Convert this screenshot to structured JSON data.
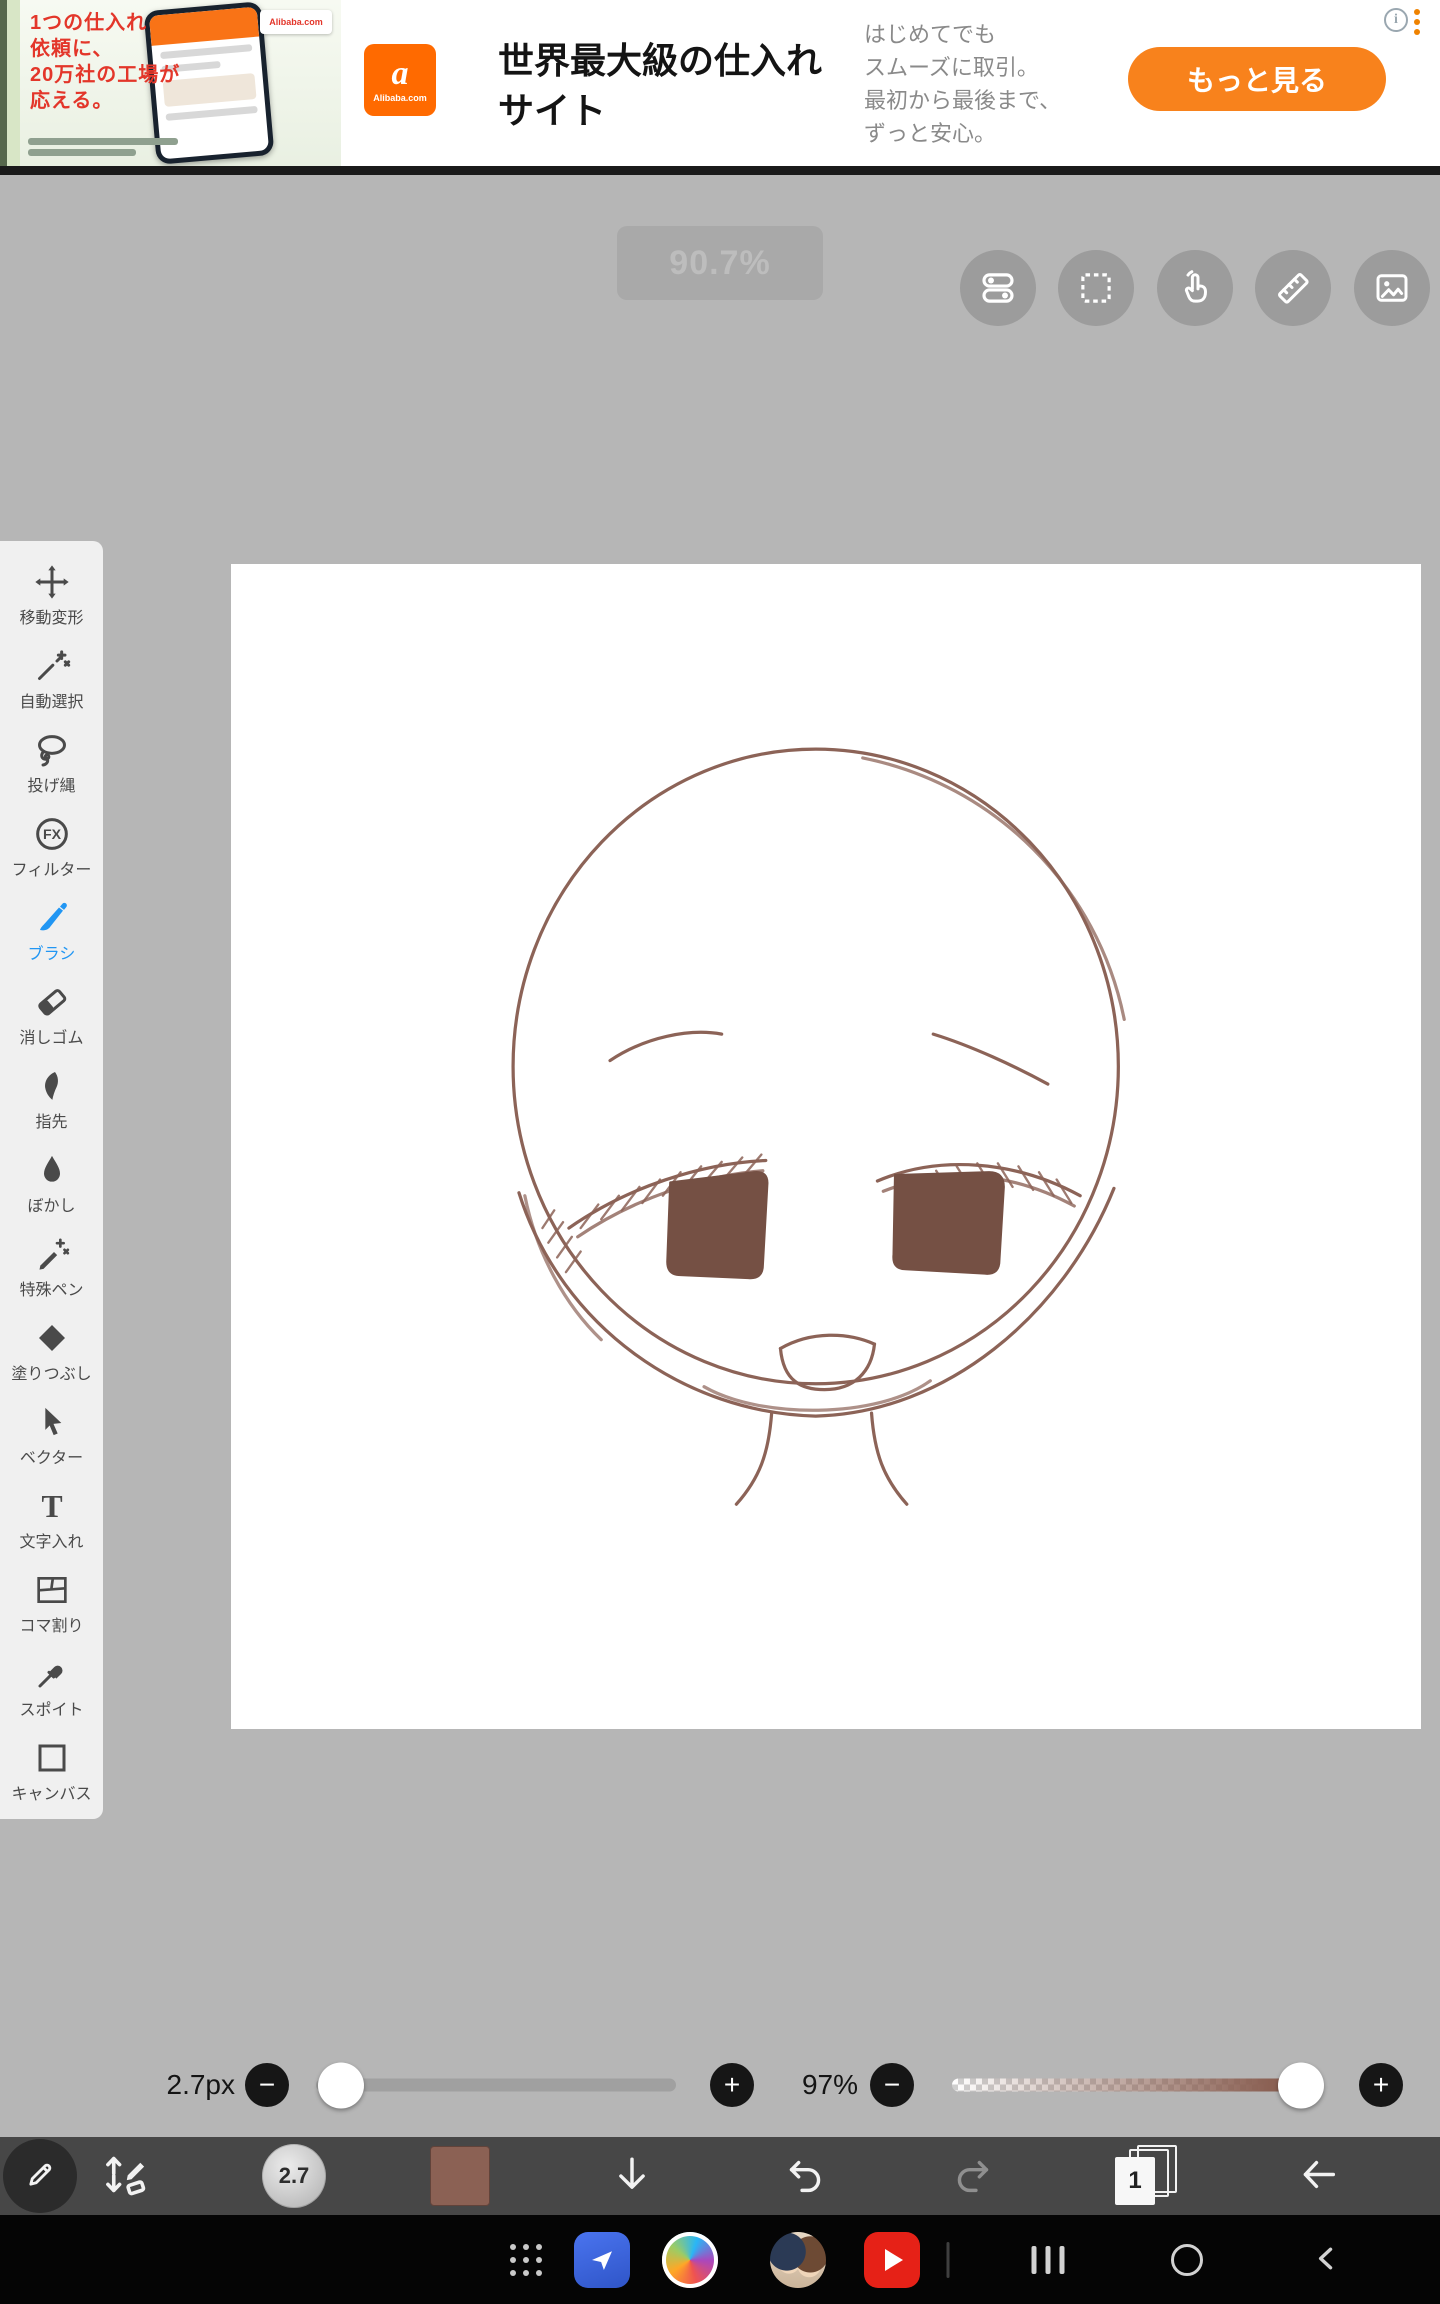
{
  "ad": {
    "creative": {
      "lines": [
        "1つの仕入れ",
        "依頼に、",
        "20万社の工場が",
        "応える。"
      ]
    },
    "logo": {
      "mark": "a",
      "label": "Alibaba.com"
    },
    "headline": {
      "line1": "世界最大級の仕入れ",
      "line2": "サイト"
    },
    "body": {
      "line1": "はじめてでも",
      "line2": "スムーズに取引。",
      "line3": "最初から最後まで、",
      "line4": "ずっと安心。"
    },
    "cta_label": "もっと見る",
    "info_glyph": "i"
  },
  "workspace": {
    "zoom_indicator": "90.7%"
  },
  "top_buttons": [
    "panel-toggle-icon",
    "selection-icon",
    "touch-icon",
    "ruler-icon",
    "material-icon"
  ],
  "sidebar": {
    "items": [
      {
        "label": "移動変形",
        "icon": "move-transform-icon",
        "selected": false
      },
      {
        "label": "自動選択",
        "icon": "auto-select-icon",
        "selected": false
      },
      {
        "label": "投げ縄",
        "icon": "lasso-icon",
        "selected": false
      },
      {
        "label": "フィルター",
        "icon": "filter-fx-icon",
        "selected": false
      },
      {
        "label": "ブラシ",
        "icon": "brush-icon",
        "selected": true
      },
      {
        "label": "消しゴム",
        "icon": "eraser-icon",
        "selected": false
      },
      {
        "label": "指先",
        "icon": "smudge-icon",
        "selected": false
      },
      {
        "label": "ぼかし",
        "icon": "blur-icon",
        "selected": false
      },
      {
        "label": "特殊ペン",
        "icon": "special-pen-icon",
        "selected": false
      },
      {
        "label": "塗りつぶし",
        "icon": "fill-icon",
        "selected": false
      },
      {
        "label": "ベクター",
        "icon": "vector-icon",
        "selected": false
      },
      {
        "label": "文字入れ",
        "icon": "text-icon",
        "selected": false
      },
      {
        "label": "コマ割り",
        "icon": "panel-divide-icon",
        "selected": false
      },
      {
        "label": "スポイト",
        "icon": "eyedropper-icon",
        "selected": false
      },
      {
        "label": "キャンバス",
        "icon": "canvas-icon",
        "selected": false
      }
    ]
  },
  "controls": {
    "minus_glyph": "−",
    "plus_glyph": "+",
    "brush_size": {
      "label": "2.7px",
      "position_pct": 7
    },
    "opacity": {
      "label": "97%",
      "position_pct": 97,
      "color": "#8b6154"
    }
  },
  "toolbar": {
    "brush_preview_label": "2.7",
    "current_color": "#8b6154",
    "layers_count": "1",
    "icons": [
      "pen-tool-icon",
      "brush-eraser-toggle-icon",
      "brush-preview",
      "color-swatch",
      "down-arrow-icon",
      "undo-icon",
      "redo-icon",
      "layers-icon",
      "back-arrow-icon"
    ]
  },
  "navbar": {
    "icons": [
      "app-grid-icon",
      "blue-app-icon",
      "ibispaint-app-icon",
      "gallery-app-icon",
      "youtube-app-icon",
      "recents-icon",
      "home-icon",
      "back-icon"
    ]
  },
  "glyphs": {
    "fx": "FX",
    "text_tool": "T"
  },
  "colors": {
    "accent_blue": "#2196f3",
    "ad_orange": "#f8821c",
    "sketch_line": "#8c6357",
    "pupil": "#755044"
  }
}
